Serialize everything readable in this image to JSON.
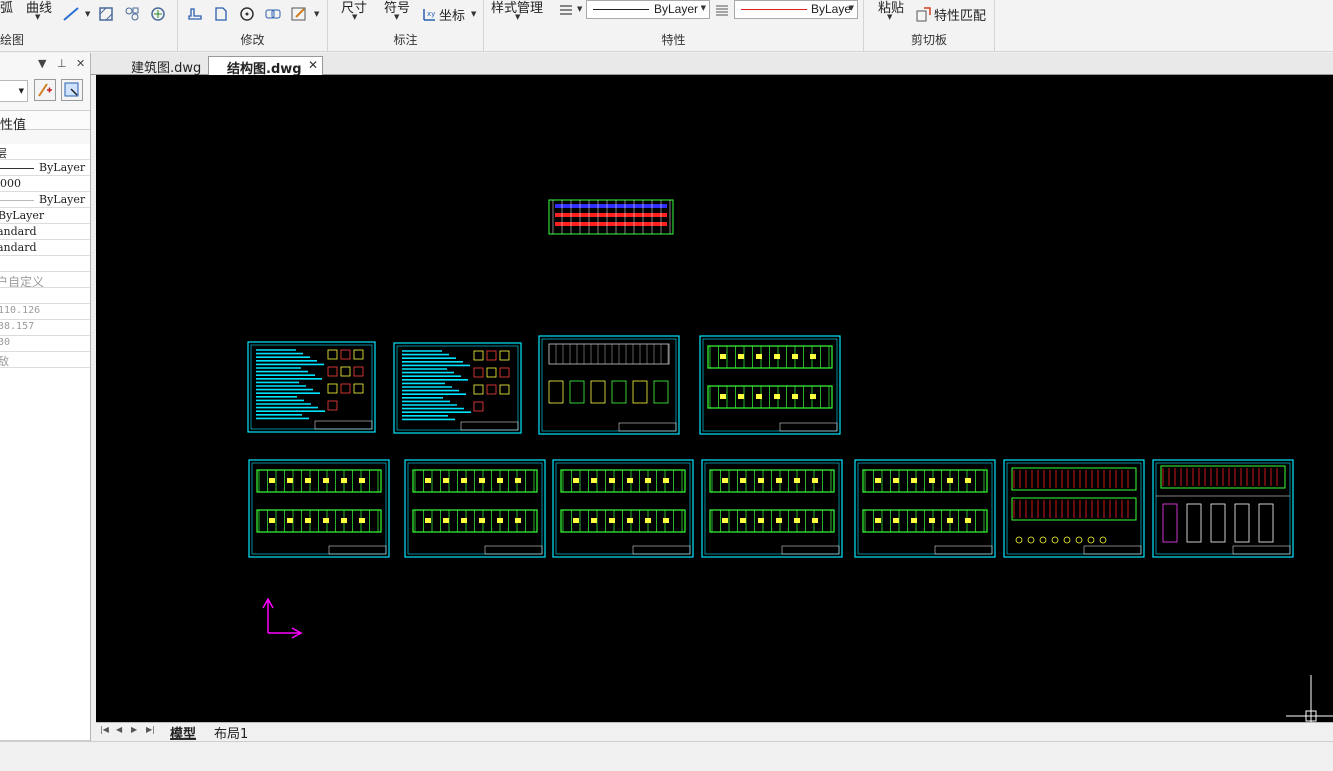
{
  "ribbon": {
    "draw": {
      "arc": "弧",
      "curve": "曲线",
      "label": "绘图"
    },
    "modify": {
      "label": "修改"
    },
    "annotate": {
      "dimension": "尺寸",
      "symbol": "符号",
      "coordinate": "坐标",
      "label": "标注"
    },
    "properties": {
      "style_manager": "样式管理",
      "linetype": "ByLayer",
      "color": "ByLaye",
      "label": "特性"
    },
    "clipboard": {
      "paste": "粘贴",
      "match": "特性匹配",
      "label": "剪切板"
    }
  },
  "panel": {
    "header_title": "性值",
    "rows": [
      "层",
      "ByLayer",
      "000",
      "ByLayer",
      "ByLayer",
      "andard",
      "andard",
      "",
      "户自定义",
      "",
      "110.126",
      "38.157",
      "30",
      "敌"
    ]
  },
  "tabs": [
    {
      "label": "建筑图.dwg",
      "active": false
    },
    {
      "label": "结构图.dwg",
      "active": true
    }
  ],
  "layout_tabs": [
    {
      "label": "模型",
      "active": true
    },
    {
      "label": "布局1",
      "active": false
    }
  ],
  "colors": {
    "canvas": "#000000",
    "frame": "#00e5ff",
    "grid": "#39ff39",
    "ucs": "#ff00ff",
    "line_red": "#ff2020",
    "line_blue": "#3030ff"
  }
}
